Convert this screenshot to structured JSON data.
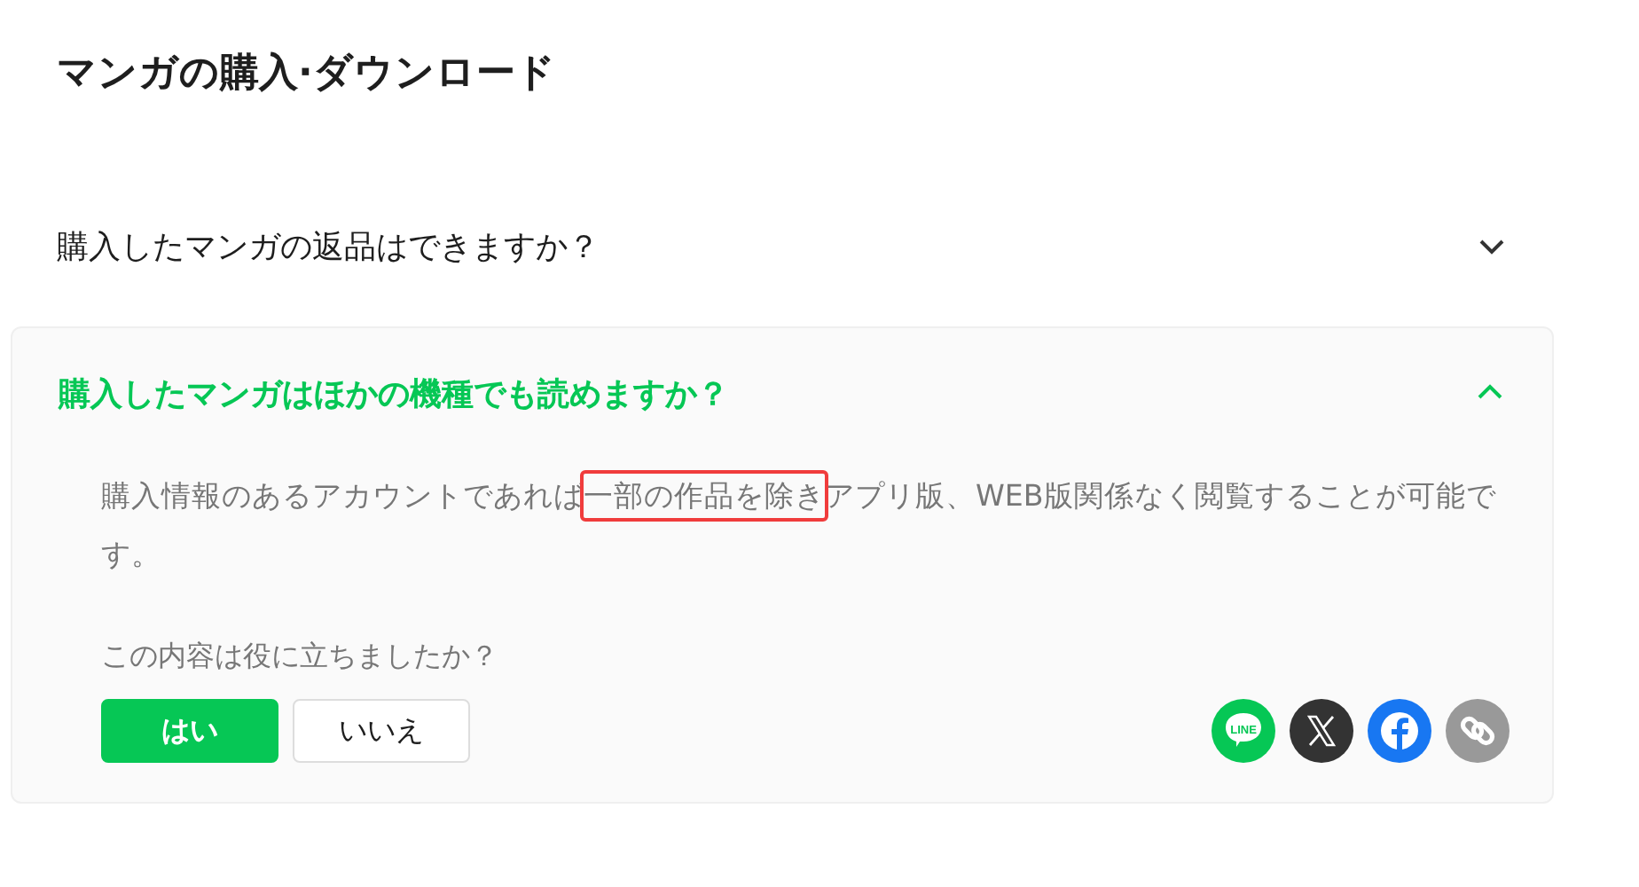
{
  "title": "マンガの購入·ダウンロード",
  "faqs": [
    {
      "question": "購入したマンガの返品はできますか？",
      "expanded": false
    },
    {
      "question": "購入したマンガはほかの機種でも読めますか？",
      "expanded": true,
      "answer_parts": [
        {
          "text": "購入情報のあるアカウントであれば",
          "highlighted": false
        },
        {
          "text": "一部の作品を除き",
          "highlighted": true
        },
        {
          "text": "アプリ版、WEB版関係なく閲覧することが可能です。",
          "highlighted": false
        }
      ],
      "feedback": {
        "prompt": "この内容は役に立ちましたか？",
        "buttons": [
          {
            "label": "はい",
            "selected": true
          },
          {
            "label": "いいえ",
            "selected": false
          }
        ]
      },
      "share": [
        {
          "kind": "line",
          "logo_text": "LINE"
        },
        {
          "kind": "x"
        },
        {
          "kind": "facebook"
        },
        {
          "kind": "link"
        }
      ]
    }
  ]
}
